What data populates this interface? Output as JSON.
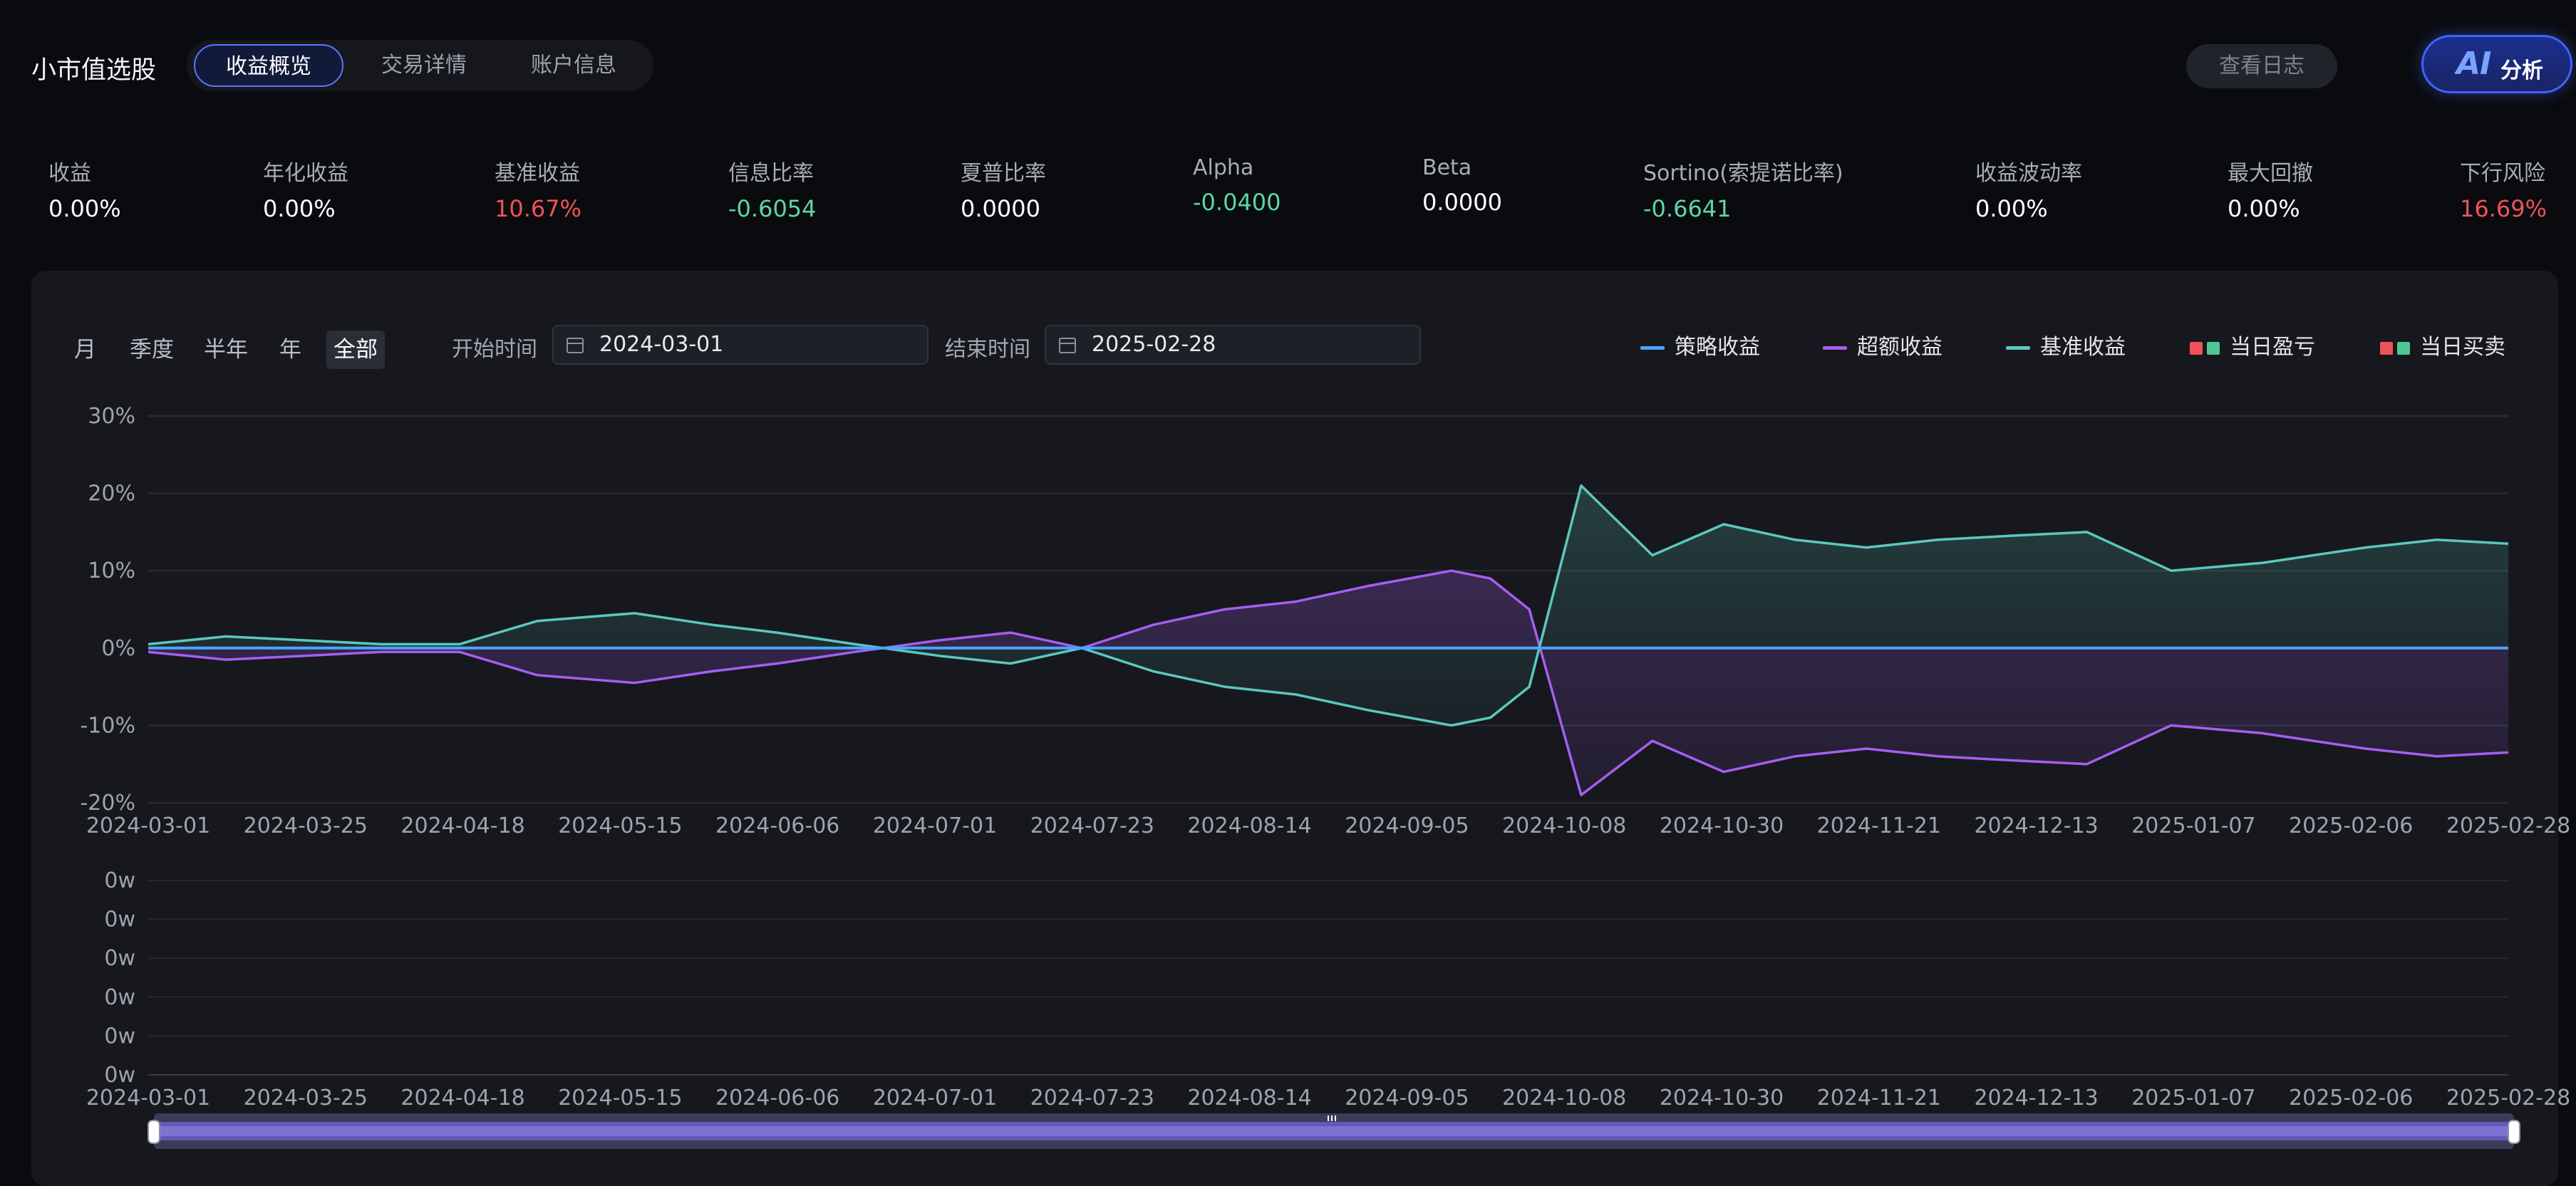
{
  "app": {
    "title": "小市值选股"
  },
  "tabs": [
    {
      "label": "收益概览",
      "active": true
    },
    {
      "label": "交易详情",
      "active": false
    },
    {
      "label": "账户信息",
      "active": false
    }
  ],
  "actions": {
    "log_label": "查看日志",
    "ai_badge": "AI",
    "ai_label": "分析"
  },
  "metrics": [
    {
      "label": "收益",
      "value": "0.00%"
    },
    {
      "label": "年化收益",
      "value": "0.00%"
    },
    {
      "label": "基准收益",
      "value": "10.67%",
      "tone": "red"
    },
    {
      "label": "信息比率",
      "value": "-0.6054",
      "tone": "green"
    },
    {
      "label": "夏普比率",
      "value": "0.0000"
    },
    {
      "label": "Alpha",
      "value": "-0.0400",
      "tone": "green"
    },
    {
      "label": "Beta",
      "value": "0.0000"
    },
    {
      "label": "Sortino(索提诺比率)",
      "value": "-0.6641",
      "tone": "green"
    },
    {
      "label": "收益波动率",
      "value": "0.00%"
    },
    {
      "label": "最大回撤",
      "value": "0.00%"
    },
    {
      "label": "下行风险",
      "value": "16.69%",
      "tone": "red"
    }
  ],
  "filters": {
    "periods": [
      {
        "label": "月"
      },
      {
        "label": "季度"
      },
      {
        "label": "半年"
      },
      {
        "label": "年"
      },
      {
        "label": "全部",
        "active": true
      }
    ],
    "start_label": "开始时间",
    "start_value": "2024-03-01",
    "end_label": "结束时间",
    "end_value": "2025-02-28"
  },
  "legend": [
    {
      "label": "策略收益",
      "color": "#4da3ff",
      "kind": "line"
    },
    {
      "label": "超额收益",
      "color": "#a55ef0",
      "kind": "line"
    },
    {
      "label": "基准收益",
      "color": "#5cc7bd",
      "kind": "line"
    },
    {
      "label": "当日盈亏",
      "colors": [
        "#f0525a",
        "#4fc792"
      ],
      "kind": "squares"
    },
    {
      "label": "当日买卖",
      "colors": [
        "#f0525a",
        "#4fc792"
      ],
      "kind": "squares"
    }
  ],
  "chart_data": [
    {
      "type": "line",
      "y_tick_labels": [
        "30%",
        "20%",
        "10%",
        "0%",
        "-10%",
        "-20%"
      ],
      "ylim": [
        -20,
        30
      ],
      "x_tick_labels": [
        "2024-03-01",
        "2024-03-25",
        "2024-04-18",
        "2024-05-15",
        "2024-06-06",
        "2024-07-01",
        "2024-07-23",
        "2024-08-14",
        "2024-09-05",
        "2024-10-08",
        "2024-10-30",
        "2024-11-21",
        "2024-12-13",
        "2025-01-07",
        "2025-02-06",
        "2025-02-28"
      ],
      "x": [
        "2024-03-01",
        "2024-03-13",
        "2024-03-25",
        "2024-04-06",
        "2024-04-18",
        "2024-04-30",
        "2024-05-15",
        "2024-05-27",
        "2024-06-06",
        "2024-06-18",
        "2024-07-01",
        "2024-07-12",
        "2024-07-23",
        "2024-08-03",
        "2024-08-14",
        "2024-08-25",
        "2024-09-05",
        "2024-09-18",
        "2024-09-24",
        "2024-09-30",
        "2024-10-08",
        "2024-10-19",
        "2024-10-30",
        "2024-11-10",
        "2024-11-21",
        "2024-12-02",
        "2024-12-13",
        "2024-12-25",
        "2025-01-07",
        "2025-01-21",
        "2025-02-06",
        "2025-02-17",
        "2025-02-28"
      ],
      "series": [
        {
          "name": "策略收益",
          "values": [
            0,
            0,
            0,
            0,
            0,
            0,
            0,
            0,
            0,
            0,
            0,
            0,
            0,
            0,
            0,
            0,
            0,
            0,
            0,
            0,
            0,
            0,
            0,
            0,
            0,
            0,
            0,
            0,
            0,
            0,
            0,
            0,
            0
          ]
        },
        {
          "name": "超额收益",
          "values": [
            -0.5,
            -1.5,
            -1,
            -0.5,
            -0.5,
            -3.5,
            -4.5,
            -3,
            -2,
            -0.5,
            1,
            2,
            0,
            3,
            5,
            6,
            8,
            10,
            9,
            5,
            -19,
            -12,
            -16,
            -14,
            -13,
            -14,
            -14.5,
            -15,
            -10,
            -11,
            -13,
            -14,
            -13.5
          ]
        },
        {
          "name": "基准收益",
          "values": [
            0.5,
            1.5,
            1,
            0.5,
            0.5,
            3.5,
            4.5,
            3,
            2,
            0.5,
            -1,
            -2,
            0,
            -3,
            -5,
            -6,
            -8,
            -10,
            -9,
            -5,
            21,
            12,
            16,
            14,
            13,
            14,
            14.5,
            15,
            10,
            11,
            13,
            14,
            13.5
          ]
        }
      ]
    },
    {
      "type": "bar",
      "y_tick_labels": [
        "0w",
        "0w",
        "0w",
        "0w",
        "0w",
        "0w"
      ],
      "x_tick_labels": [
        "2024-03-01",
        "2024-03-25",
        "2024-04-18",
        "2024-05-15",
        "2024-06-06",
        "2024-07-01",
        "2024-07-23",
        "2024-08-14",
        "2024-09-05",
        "2024-10-08",
        "2024-10-30",
        "2024-11-21",
        "2024-12-13",
        "2025-01-07",
        "2025-02-06",
        "2025-02-28"
      ],
      "series": [
        {
          "values": []
        }
      ]
    }
  ]
}
